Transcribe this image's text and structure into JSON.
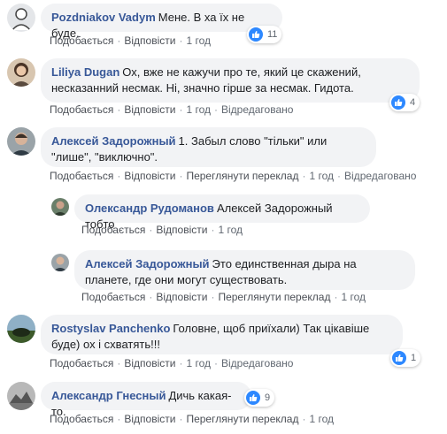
{
  "common": {
    "like": "Подобається",
    "reply": "Відповісти",
    "translate": "Переглянути переклад",
    "edited": "Відредаговано",
    "time": "1 год",
    "sep": "·"
  },
  "comments": [
    {
      "author": "Pozdniakov Vadym",
      "text": "Мене. В ха їх не буде.",
      "reactions": "11"
    },
    {
      "author": "Liliya Dugan",
      "text": "Ох, вже не кажучи про те, який це скажений, несказанний несмак. Ні, значно гірше за несмак. Гидота.",
      "reactions": "4"
    },
    {
      "author": "Алексей Задорожный",
      "text": "1. Забыл слово \"тільки\" или \"лише\", \"виключно\"."
    },
    {
      "author": "Олександр Рудоманов",
      "text": "Алексей Задорожный тобто"
    },
    {
      "author": "Алексей Задорожный",
      "text": "Это единственная дыра на планете, где они могут существовать."
    },
    {
      "author": "Rostyslav Panchenko",
      "text": "Головне, щоб приїхали) Так цікавіше буде) ох і схватять!!!",
      "reactions": "1"
    },
    {
      "author": "Александр Гнесный",
      "text": "Дичь какая-то.",
      "reactions": "9"
    }
  ]
}
